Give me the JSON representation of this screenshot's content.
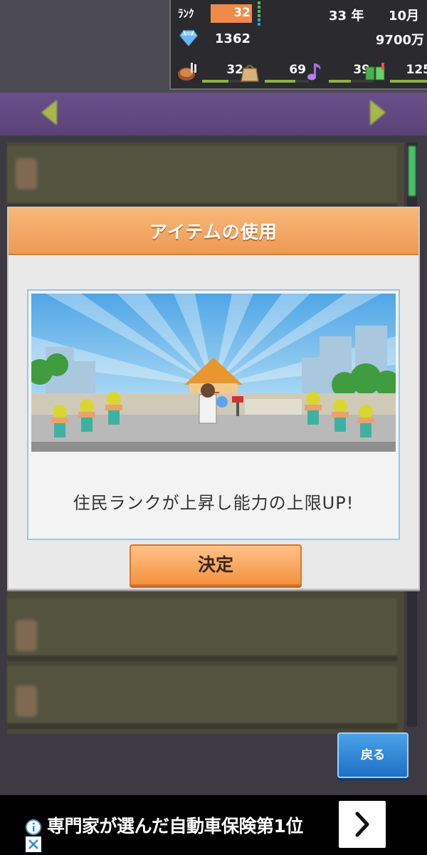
{
  "hud": {
    "rank_label": "ﾗﾝｸ",
    "rank_value": "32",
    "year": "33 年",
    "month": "10月",
    "gems": "1362",
    "money": "9700万",
    "stats": [
      {
        "icon": "food-icon",
        "value": "32",
        "bar_color": "#8fb33a",
        "fill": 0.6
      },
      {
        "icon": "bag-icon",
        "value": "69",
        "bar_color": "#8fb33a",
        "fill": 0.7
      },
      {
        "icon": "music-note-icon",
        "value": "39",
        "bar_color": "#8fb33a",
        "fill": 0.5
      },
      {
        "icon": "book-icon",
        "value": "125",
        "bar_color": "#8fb33a",
        "fill": 0.9
      }
    ]
  },
  "modal": {
    "title": "アイテムの使用",
    "message": "住民ランクが上昇し能力の上限UP!",
    "confirm_label": "決定"
  },
  "back_label": "戻る",
  "ad": {
    "text": "専門家が選んだ自動車保険第1位"
  },
  "colors": {
    "header_orange": "#ee9a52",
    "back_blue": "#1f6fc4"
  }
}
